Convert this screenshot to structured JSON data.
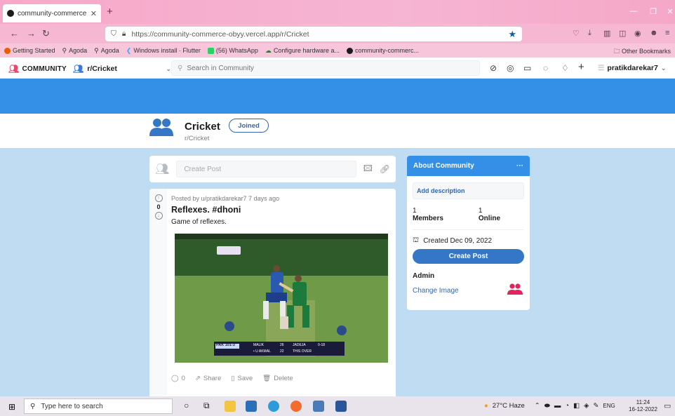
{
  "browser": {
    "tab_title": "community-commerce-obyy.ver",
    "url": "https://community-commerce-obyy.vercel.app/r/Cricket",
    "bookmarks": [
      {
        "label": "Getting Started",
        "color": "#e66000"
      },
      {
        "label": "Agoda",
        "color": "#6f6f6f"
      },
      {
        "label": "Agoda",
        "color": "#6f6f6f"
      },
      {
        "label": "Windows install · Flutter",
        "color": "#42a5f5"
      },
      {
        "label": "(56) WhatsApp",
        "color": "#25d366"
      },
      {
        "label": "Configure hardware a...",
        "color": "#2e7d32"
      },
      {
        "label": "community-commerc...",
        "color": "#1c1c1c"
      }
    ],
    "other_bookmarks": "Other Bookmarks"
  },
  "header": {
    "logo": "COMMUNITY",
    "community": "r/Cricket",
    "search_placeholder": "Search in Community",
    "username": "pratikdarekar7"
  },
  "community": {
    "name": "Cricket",
    "sub": "r/Cricket",
    "joined_label": "Joined"
  },
  "create_post": {
    "placeholder": "Create Post"
  },
  "post": {
    "votes": "0",
    "meta": "Posted by u/pratikdarekar7 7 days ago",
    "title": "Reflexes. #dhoni",
    "body": "Game of reflexes.",
    "comments": "0",
    "share": "Share",
    "save": "Save",
    "delete": "Delete",
    "scoreboard": {
      "team": "PAK 101-3",
      "batter1": "MALIK",
      "batter1_score": "26",
      "batter2": "• U AKMAL",
      "batter2_score": "22",
      "bowler": "JADEJA",
      "bowler_fig": "0-18",
      "this_over": "THIS OVER"
    }
  },
  "about": {
    "title": "About Community",
    "add_description": "Add description",
    "members_count": "1",
    "members_label": "Members",
    "online_count": "1",
    "online_label": "Online",
    "created": "Created Dec 09, 2022",
    "create_post_button": "Create Post",
    "admin_label": "Admin",
    "change_image": "Change Image"
  },
  "taskbar": {
    "search_placeholder": "Type here to search",
    "weather": "27°C Haze",
    "lang": "ENG",
    "time": "11:24",
    "date": "16-12-2022"
  },
  "colors": {
    "banner": "#3490e6",
    "accent": "#3477c6",
    "page_bg": "#bfdcf2",
    "logo": "#e64a6b"
  }
}
